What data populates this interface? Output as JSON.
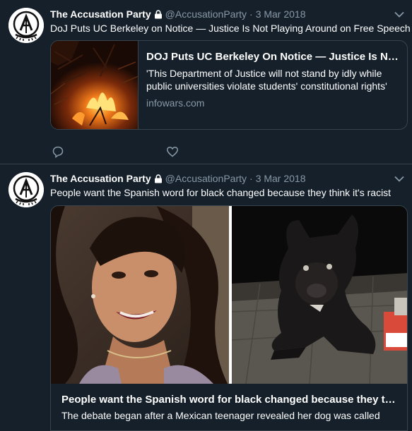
{
  "colors": {
    "background": "#15202b",
    "border": "#38444d",
    "muted": "#8899a6",
    "text": "#ffffff"
  },
  "tweets": [
    {
      "name": "The Accusation Party",
      "handle": "@AccusationParty",
      "separator": "·",
      "date": "3 Mar 2018",
      "text": "DoJ Puts UC Berkeley on Notice — Justice Is Not Playing Around on Free Speech",
      "card": {
        "title": "DOJ Puts UC Berkeley On Notice — Justice Is Not Playing Around on Free Speech",
        "description": "'This Department of Justice will not stand by idly while public universities violate students' constitutional rights'",
        "domain": "infowars.com",
        "image": "fire-at-night-photo"
      },
      "icons": [
        "lock-icon",
        "chevron-down-icon",
        "reply-icon",
        "like-icon"
      ]
    },
    {
      "name": "The Accusation Party",
      "handle": "@AccusationParty",
      "separator": "·",
      "date": "3 Mar 2018",
      "text": "People want the Spanish word for black changed because they think it's racist",
      "card": {
        "title": "People want the Spanish word for black changed because they think it's racist",
        "description": "The debate began after a Mexican teenager revealed her dog was called",
        "images": [
          "smiling-woman-photo",
          "black-dog-photo"
        ]
      },
      "icons": [
        "lock-icon",
        "chevron-down-icon"
      ]
    }
  ]
}
